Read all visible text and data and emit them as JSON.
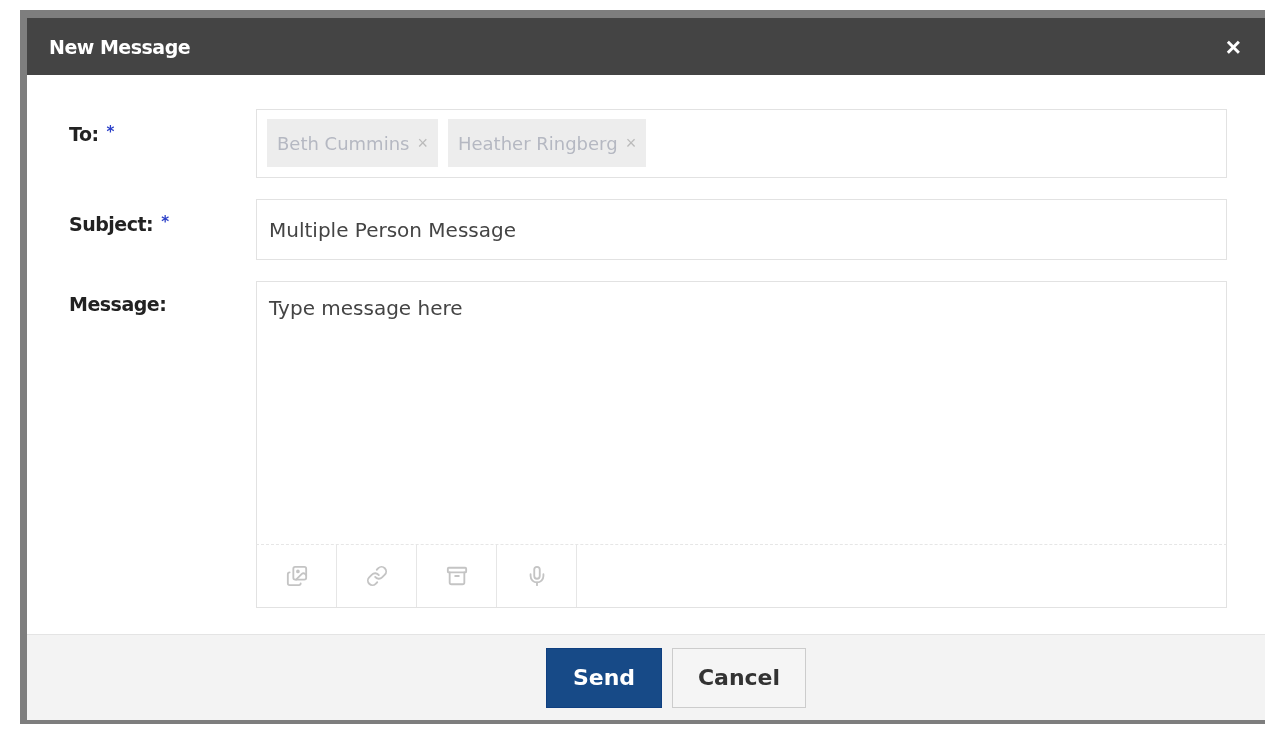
{
  "dialog": {
    "title": "New Message",
    "close": "×"
  },
  "fields": [
    {
      "kind": "recipients",
      "label": "To:",
      "required_mark": "*",
      "chips": [
        {
          "name": "Beth Cummins",
          "remove": "×"
        },
        {
          "name": "Heather Ringberg",
          "remove": "×"
        }
      ]
    },
    {
      "kind": "text",
      "label": "Subject:",
      "required_mark": "*",
      "value": "Multiple Person Message"
    },
    {
      "kind": "textarea",
      "label": "Message:",
      "placeholder": "Type message here",
      "tools": [
        {
          "kind": "image",
          "disabled": true
        },
        {
          "kind": "link",
          "disabled": true
        },
        {
          "kind": "archive",
          "disabled": true
        },
        {
          "kind": "mic",
          "disabled": true
        }
      ]
    }
  ],
  "buttons": [
    {
      "label": "Send",
      "kind": "primary"
    },
    {
      "label": "Cancel",
      "kind": "secondary"
    }
  ]
}
